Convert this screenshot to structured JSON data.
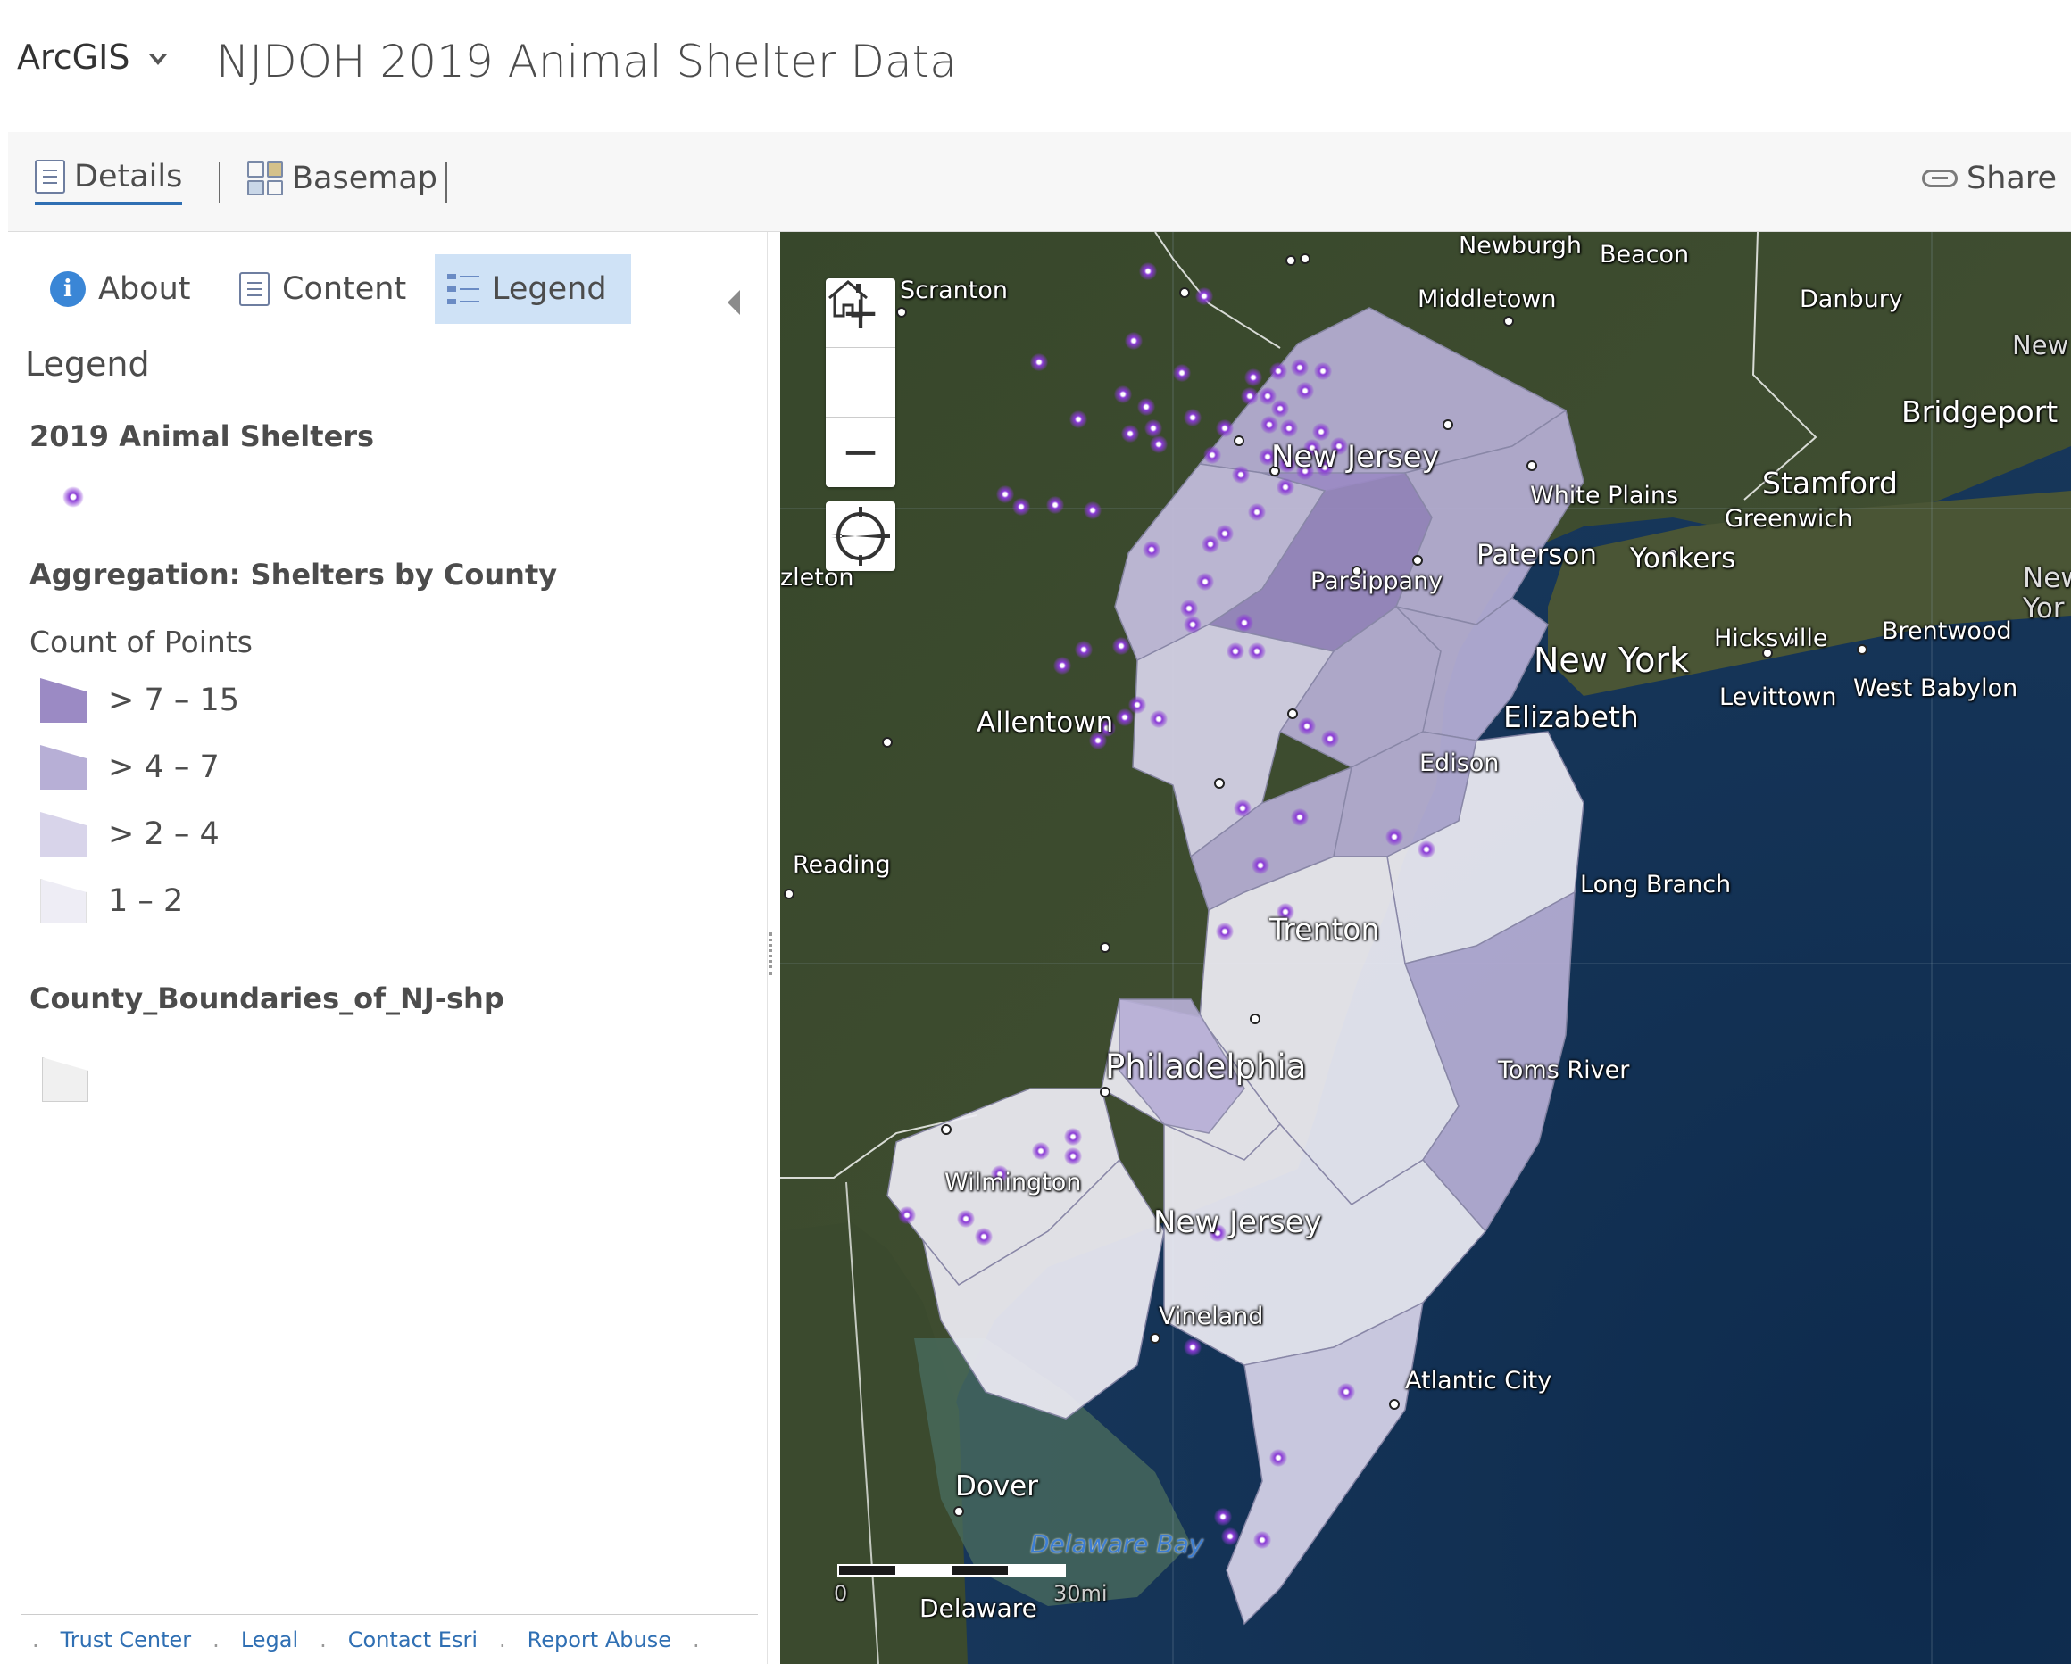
{
  "header": {
    "brand": "ArcGIS",
    "title": "NJDOH 2019 Animal Shelter Data"
  },
  "toolbar": {
    "details_label": "Details",
    "basemap_label": "Basemap",
    "share_label": "Share"
  },
  "panel": {
    "tabs": [
      {
        "label": "About"
      },
      {
        "label": "Content"
      },
      {
        "label": "Legend",
        "active": true
      }
    ],
    "legend_heading": "Legend",
    "layers": [
      {
        "title": "2019 Animal Shelters"
      },
      {
        "title": "Aggregation: Shelters by County",
        "field": "Count of Points",
        "classes": [
          {
            "label": "> 7 – 15",
            "color": "#9b8ac4"
          },
          {
            "label": "> 4 – 7",
            "color": "#b7afd6"
          },
          {
            "label": "> 2 – 4",
            "color": "#d8d4ea"
          },
          {
            "label": "1 – 2",
            "color": "#eeedf5"
          }
        ]
      },
      {
        "title": "County_Boundaries_of_NJ-shp"
      }
    ],
    "footer_links": [
      "Trust Center",
      "Legal",
      "Contact Esri",
      "Report Abuse"
    ]
  },
  "map": {
    "labels": {
      "newburgh": "Newburgh",
      "beacon": "Beacon",
      "scranton": "Scranton",
      "middletown": "Middletown",
      "danbury": "Danbury",
      "new_ct": "New",
      "bridgeport": "Bridgeport",
      "new_jersey_n": "New Jersey",
      "white_plains": "White Plains",
      "stamford": "Stamford",
      "greenwich": "Greenwich",
      "paterson": "Paterson",
      "yonkers": "Yonkers",
      "hazleton": "zleton",
      "parsippany": "Parsippany",
      "new_york_r1": "New",
      "new_york_r2": "Yor",
      "hicksville": "Hicksville",
      "brentwood": "Brentwood",
      "new_york": "New York",
      "levittown": "Levittown",
      "west_babylon": "West Babylon",
      "allentown": "Allentown",
      "elizabeth": "Elizabeth",
      "edison": "Edison",
      "reading": "Reading",
      "long_branch": "Long Branch",
      "trenton": "Trenton",
      "philadelphia": "Philadelphia",
      "toms_river": "Toms River",
      "wilmington": "Wilmington",
      "new_jersey_s": "New Jersey",
      "vineland": "Vineland",
      "atlantic_city": "Atlantic City",
      "dover": "Dover",
      "delaware_bay": "Delaware Bay",
      "delaware": "Delaware",
      "scale_zero": "0",
      "scale_end": "30mi"
    }
  }
}
